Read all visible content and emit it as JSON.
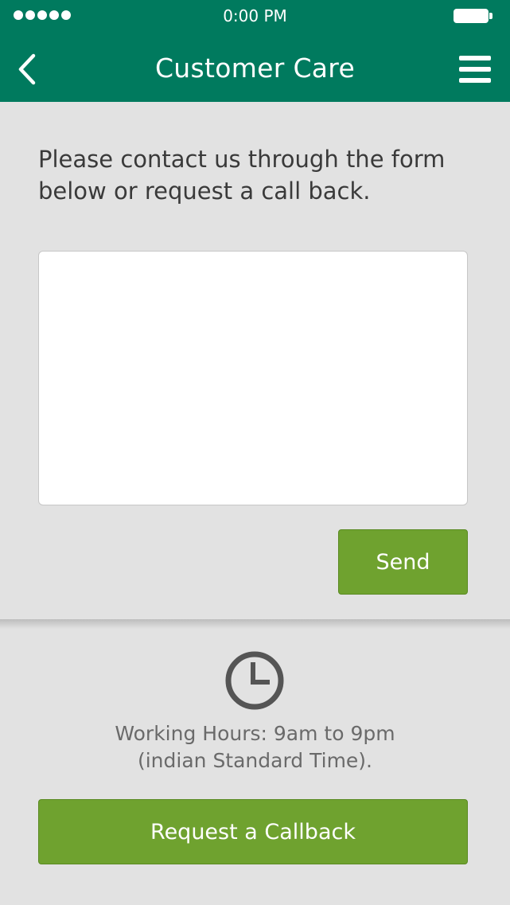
{
  "status_bar": {
    "time": "0:00 PM"
  },
  "header": {
    "title": "Customer Care",
    "back_icon": "chevron-left-icon",
    "menu_icon": "hamburger-menu-icon",
    "background_color": "#007a5e"
  },
  "contact_form": {
    "intro_line_1": "Please contact us through the form",
    "intro_line_2": "below or request a call back.",
    "message_value": "",
    "send_label": "Send"
  },
  "working_hours": {
    "icon": "clock-icon",
    "line_1": "Working Hours: 9am to 9pm",
    "line_2": "(indian Standard Time)."
  },
  "callback": {
    "button_label": "Request a Callback"
  },
  "colors": {
    "accent_green": "#6fa22f",
    "brand_teal": "#007a5e",
    "background_gray": "#e2e2e2"
  }
}
